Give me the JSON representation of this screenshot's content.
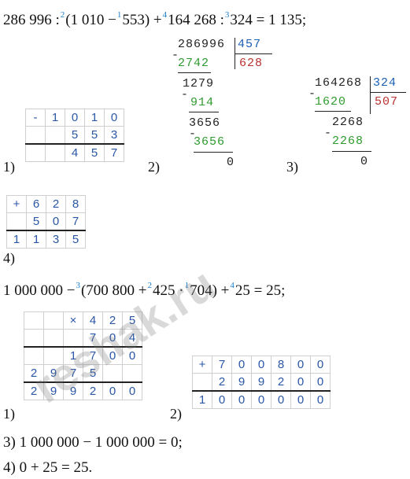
{
  "eq1": {
    "a": "286 996 :",
    "o1": "2",
    "b": "(1 010 −",
    "o2": "1",
    "c": "553) +",
    "o3": "4",
    "d": "164 268 :",
    "o4": "3",
    "e": "324 = 1 135;"
  },
  "div1": {
    "dividend": "286996",
    "divisor": "457",
    "quotient": "628",
    "s1": "2742",
    "r1": "1279",
    "s2": "914",
    "r2": "3656",
    "s3": "3656",
    "rem": "0",
    "minus": "-"
  },
  "div2": {
    "dividend": "164268",
    "divisor": "324",
    "quotient": "507",
    "s1": "1620",
    "r1": "2268",
    "s2": "2268",
    "rem": "0",
    "minus": "-"
  },
  "labels": {
    "l1": "1)",
    "l2": "2)",
    "l3": "3)",
    "l4": "4)",
    "m1": "1)",
    "m2": "2)"
  },
  "sub": {
    "op": "-",
    "r1": [
      "1",
      "0",
      "1",
      "0"
    ],
    "r2": [
      "",
      "5",
      "5",
      "3"
    ],
    "r3": [
      "",
      "4",
      "5",
      "7"
    ]
  },
  "add1": {
    "op": "+",
    "r1": [
      "6",
      "2",
      "8"
    ],
    "r2": [
      "5",
      "0",
      "7"
    ],
    "r3": [
      "1",
      "1",
      "3",
      "5"
    ]
  },
  "eq2": {
    "a": "1 000 000 −",
    "o1": "3",
    "b": "(700 800 +",
    "o2": "2",
    "c": "425 ·",
    "o3": "1",
    "d": "704) +",
    "o4": "4",
    "e": "25 = 25;"
  },
  "mul": {
    "op": "×",
    "r1": [
      "4",
      "2",
      "5"
    ],
    "r2": [
      "7",
      "0",
      "4"
    ],
    "r3": [
      "1",
      "7",
      "0",
      "0"
    ],
    "r4": [
      "2",
      "9",
      "7",
      "5",
      "",
      ""
    ],
    "r5": [
      "2",
      "9",
      "9",
      "2",
      "0",
      "0"
    ]
  },
  "add2": {
    "op": "+",
    "r1": [
      "7",
      "0",
      "0",
      "8",
      "0",
      "0"
    ],
    "r2": [
      "2",
      "9",
      "9",
      "2",
      "0",
      "0"
    ],
    "r3": [
      "1",
      "0",
      "0",
      "0",
      "0",
      "0",
      "0"
    ]
  },
  "eq3": "3) 1 000 000 − 1 000 000 = 0;",
  "eq4": "4) 0 + 25 = 25.",
  "watermark": "reshak.ru"
}
